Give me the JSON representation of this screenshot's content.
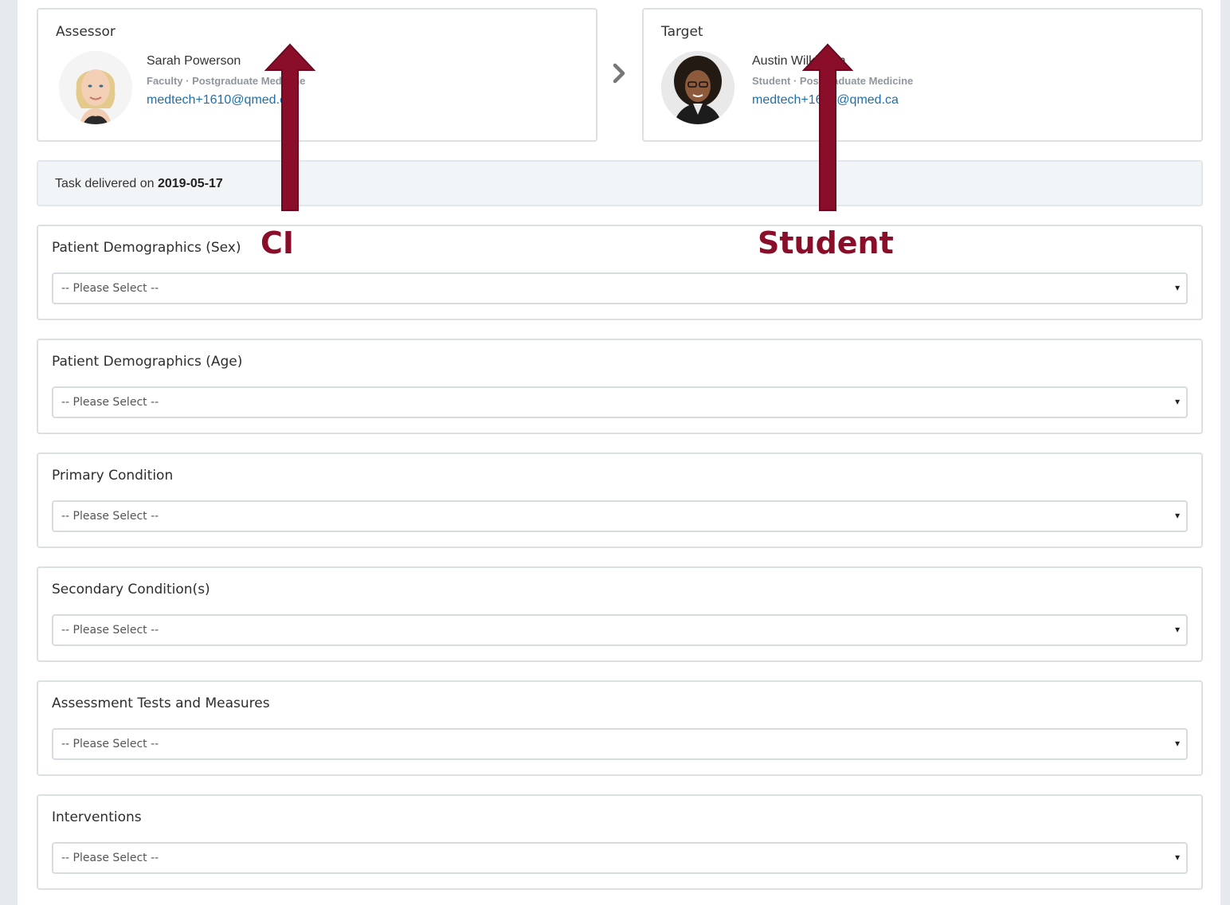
{
  "assessor": {
    "heading": "Assessor",
    "name": "Sarah Powerson",
    "role": "Faculty · Postgraduate Medicine",
    "email": "medtech+1610@qmed.ca"
  },
  "target": {
    "heading": "Target",
    "name": "Austin Wilkinson",
    "role": "Student · Postgraduate Medicine",
    "email": "medtech+1604@qmed.ca"
  },
  "notice": {
    "prefix": "Task delivered on ",
    "date": "2019-05-17"
  },
  "fields": [
    {
      "label": "Patient Demographics (Sex)",
      "value": "-- Please Select --"
    },
    {
      "label": "Patient Demographics (Age)",
      "value": "-- Please Select --"
    },
    {
      "label": "Primary Condition",
      "value": "-- Please Select --"
    },
    {
      "label": "Secondary Condition(s)",
      "value": "-- Please Select --"
    },
    {
      "label": "Assessment Tests and Measures",
      "value": "-- Please Select --"
    },
    {
      "label": "Interventions",
      "value": "-- Please Select --"
    }
  ],
  "annotations": {
    "left_label": "CI",
    "right_label": "Student",
    "color": "#8a0e2a"
  },
  "icons": {
    "separator": "chevron-right-icon",
    "select_caret": "▾"
  }
}
